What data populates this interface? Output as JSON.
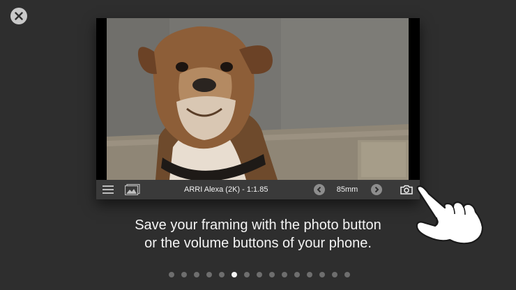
{
  "close_label": "close",
  "viewer": {
    "camera_format": "ARRI Alexa (2K) - 1:1.85",
    "lens": "85mm",
    "icons": {
      "menu": "hamburger-menu-icon",
      "gallery": "gallery-icon",
      "prev": "chevron-left-icon",
      "next": "chevron-right-icon",
      "camera": "camera-icon"
    }
  },
  "caption": {
    "line1": "Save your framing with the photo button",
    "line2": "or the volume buttons of your phone."
  },
  "pagination": {
    "total": 15,
    "active_index": 5
  },
  "colors": {
    "background": "#2e2e2e",
    "toolbar": "#3a3a3a",
    "text": "#f4f4f4",
    "dot_inactive": "#6e6e6e"
  }
}
